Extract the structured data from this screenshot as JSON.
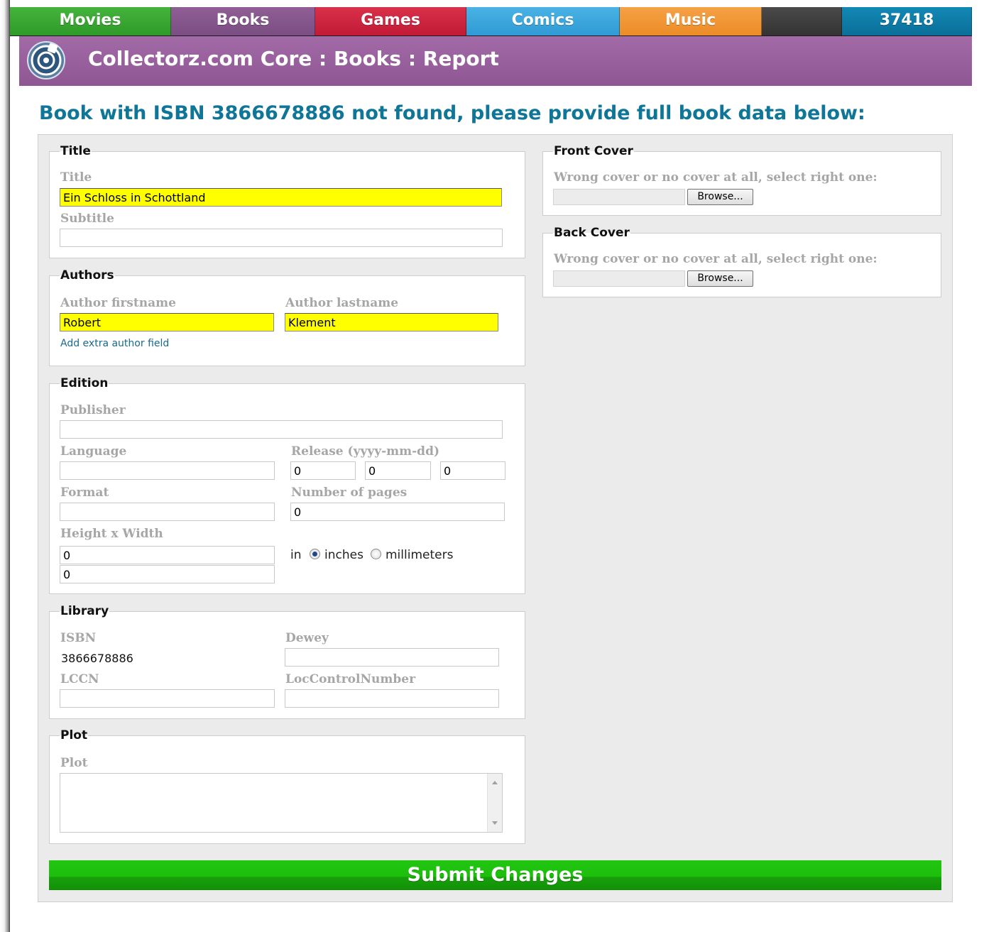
{
  "tabs": [
    {
      "label": "Movies"
    },
    {
      "label": "Books"
    },
    {
      "label": "Games"
    },
    {
      "label": "Comics"
    },
    {
      "label": "Music"
    },
    {
      "label": ""
    },
    {
      "label": "37418"
    }
  ],
  "header": {
    "title": "Collectorz.com Core : Books : Report"
  },
  "heading": "Book with ISBN 3866678886 not found, please provide full book data below:",
  "title_section": {
    "legend": "Title",
    "title_label": "Title",
    "title_value": "Ein Schloss in Schottland",
    "subtitle_label": "Subtitle",
    "subtitle_value": ""
  },
  "authors": {
    "legend": "Authors",
    "firstname_label": "Author firstname",
    "firstname_value": "Robert",
    "lastname_label": "Author lastname",
    "lastname_value": "Klement",
    "add_link": "Add extra author field"
  },
  "edition": {
    "legend": "Edition",
    "publisher_label": "Publisher",
    "publisher_value": "",
    "language_label": "Language",
    "language_value": "",
    "release_label": "Release (yyyy-mm-dd)",
    "release_year": "0",
    "release_month": "0",
    "release_day": "0",
    "format_label": "Format",
    "format_value": "",
    "pages_label": "Number of pages",
    "pages_value": "0",
    "hw_label": "Height x Width",
    "height_value": "0",
    "width_value": "0",
    "in_label": "in",
    "unit_inches": "inches",
    "unit_mm": "millimeters",
    "selected_unit": "inches"
  },
  "library": {
    "legend": "Library",
    "isbn_label": "ISBN",
    "isbn_value": "3866678886",
    "dewey_label": "Dewey",
    "dewey_value": "",
    "lccn_label": "LCCN",
    "lccn_value": "",
    "loc_label": "LocControlNumber",
    "loc_value": ""
  },
  "plot": {
    "legend": "Plot",
    "plot_label": "Plot",
    "plot_value": ""
  },
  "front_cover": {
    "legend": "Front Cover",
    "label": "Wrong cover or no cover at all, select right one:",
    "button": "Browse..."
  },
  "back_cover": {
    "legend": "Back Cover",
    "label": "Wrong cover or no cover at all, select right one:",
    "button": "Browse..."
  },
  "submit_label": "Submit Changes",
  "colors": {
    "movies": "#2e9a29",
    "books": "#7a4e83",
    "games": "#c11a36",
    "comics": "#2f9ad4",
    "music": "#ec8c26",
    "count": "#0a6f98",
    "header": "#945c98",
    "heading": "#0f7697",
    "highlight": "#ffff00",
    "submit": "#1cbf0a"
  },
  "icons": {
    "logo": "collectorz-core-logo-icon"
  }
}
